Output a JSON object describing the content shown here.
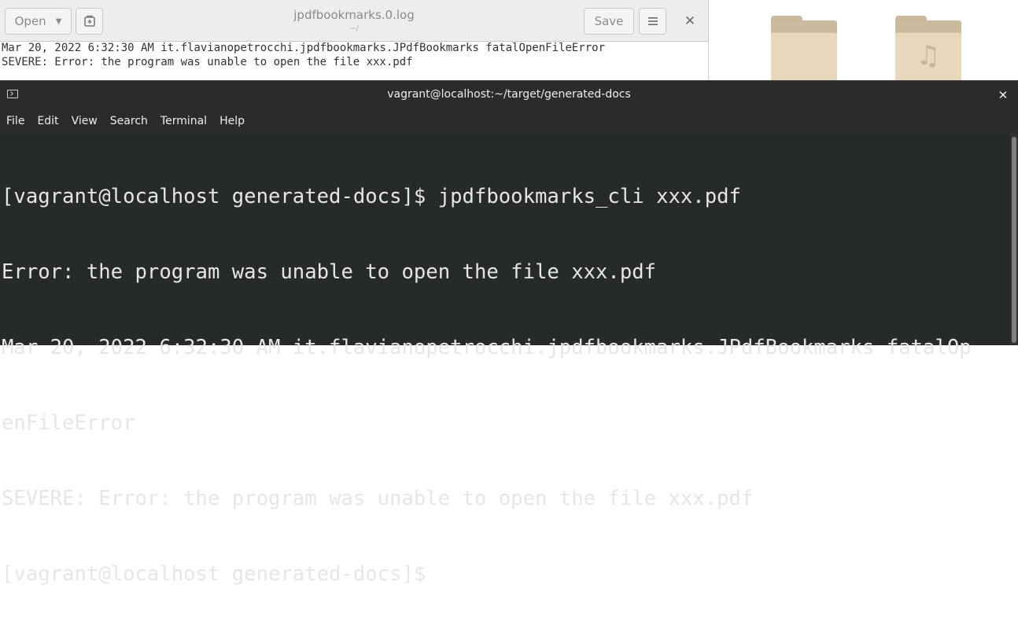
{
  "gedit": {
    "open_label": "Open",
    "title": "jpdfbookmarks.0.log",
    "subtitle": "~/",
    "save_label": "Save",
    "lines": [
      "Mar 20, 2022 6:32:30 AM it.flavianopetrocchi.jpdfbookmarks.JPdfBookmarks fatalOpenFileError",
      "SEVERE: Error: the program was unable to open the file xxx.pdf"
    ]
  },
  "terminal": {
    "title": "vagrant@localhost:~/target/generated-docs",
    "menu": [
      "File",
      "Edit",
      "View",
      "Search",
      "Terminal",
      "Help"
    ],
    "lines": [
      "[vagrant@localhost generated-docs]$ jpdfbookmarks_cli xxx.pdf",
      "Error: the program was unable to open the file xxx.pdf",
      "Mar 20, 2022 6:32:30 AM it.flavianopetrocchi.jpdfbookmarks.JPdfBookmarks fatalOp",
      "enFileError",
      "SEVERE: Error: the program was unable to open the file xxx.pdf",
      "[vagrant@localhost generated-docs]$"
    ]
  },
  "desktop": {
    "folders": [
      {
        "icon": "folder-icon"
      },
      {
        "icon": "music-folder-icon"
      }
    ]
  },
  "colors": {
    "terminal_bg": "#262a2b",
    "terminal_header": "#2b2b2b",
    "terminal_text": "#e6e6e6",
    "gedit_header": "#ededeb",
    "folder": "#e6d7bd"
  }
}
